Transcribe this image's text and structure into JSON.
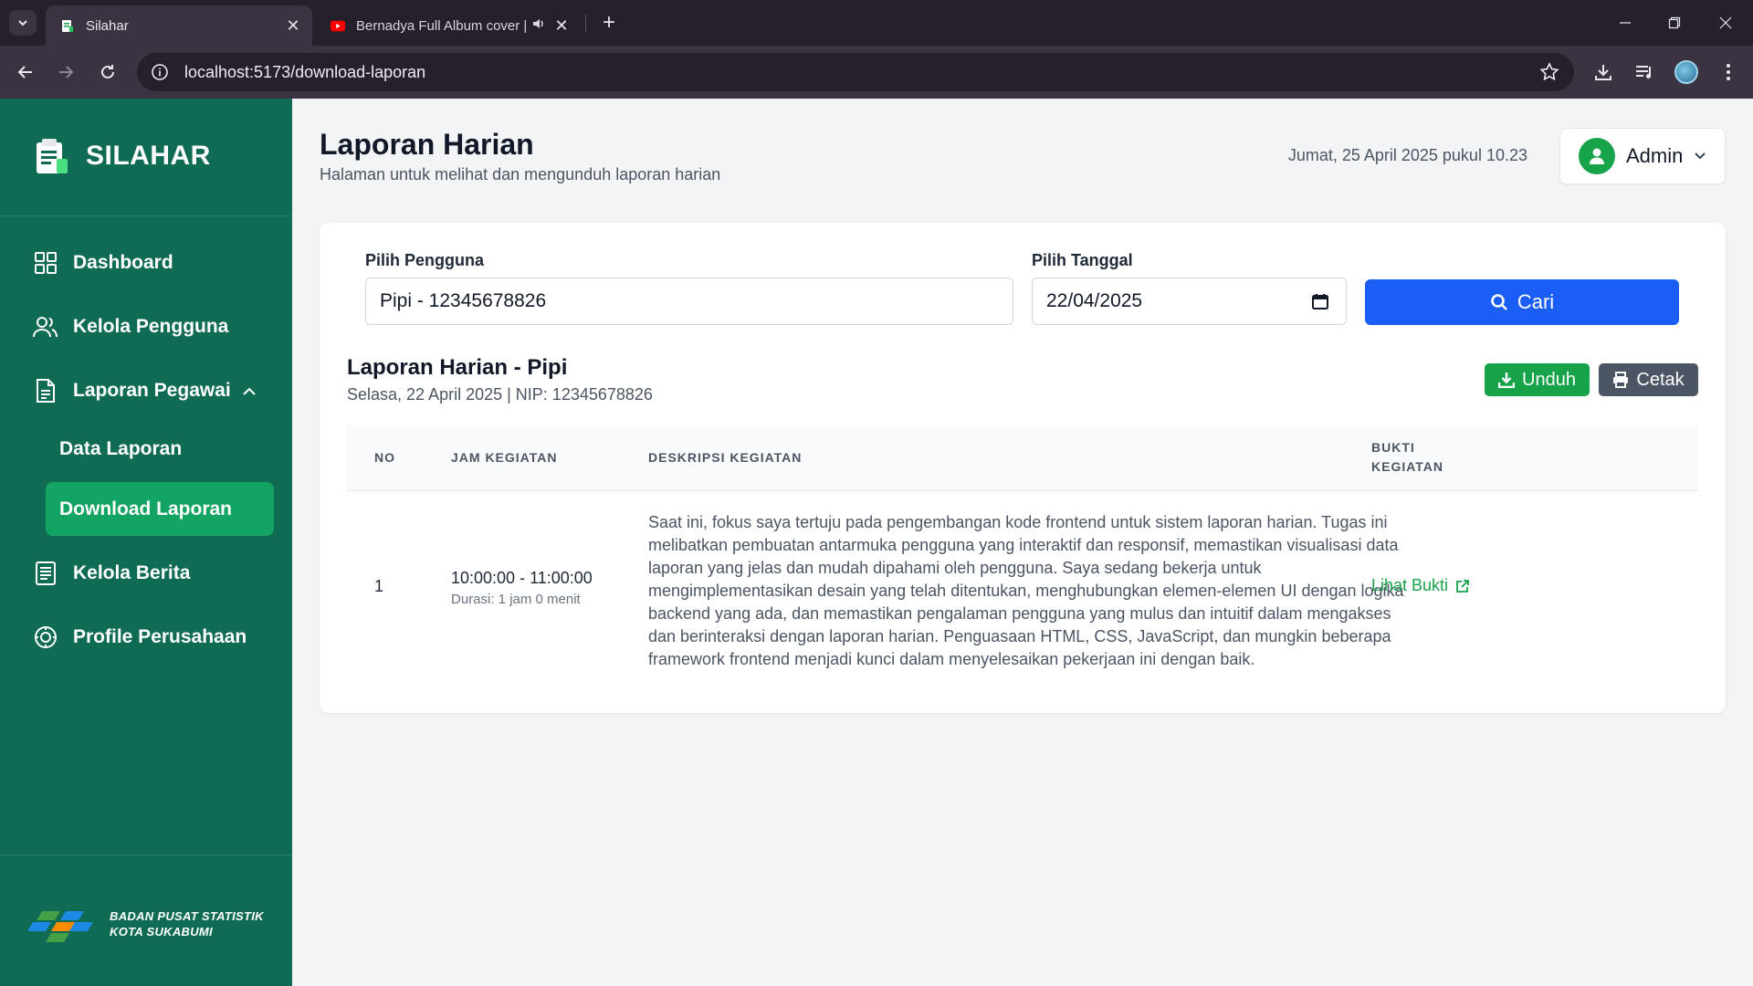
{
  "browser": {
    "tabs": [
      {
        "title": "Silahar",
        "active": true
      },
      {
        "title": "Bernadya Full Album cover |",
        "active": false
      }
    ],
    "url": "localhost:5173/download-laporan"
  },
  "sidebar": {
    "brand": "SILAHAR",
    "items": [
      {
        "label": "Dashboard",
        "icon": "grid-icon"
      },
      {
        "label": "Kelola Pengguna",
        "icon": "users-icon"
      },
      {
        "label": "Laporan Pegawai",
        "icon": "document-icon"
      },
      {
        "label": "Kelola Berita",
        "icon": "news-icon"
      },
      {
        "label": "Profile Perusahaan",
        "icon": "company-icon"
      }
    ],
    "subitems": [
      {
        "label": "Data Laporan",
        "active": false
      },
      {
        "label": "Download Laporan",
        "active": true
      }
    ],
    "footer": {
      "line1": "BADAN PUSAT STATISTIK",
      "line2": "KOTA SUKABUMI"
    }
  },
  "header": {
    "title": "Laporan Harian",
    "subtitle": "Halaman untuk melihat dan mengunduh laporan harian",
    "datetime": "Jumat, 25 April 2025 pukul 10.23",
    "user": "Admin"
  },
  "filter": {
    "user_label": "Pilih Pengguna",
    "user_value": "Pipi - 12345678826",
    "date_label": "Pilih Tanggal",
    "date_value": "22/04/2025",
    "search_label": "Cari"
  },
  "report": {
    "title": "Laporan Harian - Pipi",
    "meta": "Selasa, 22 April 2025 | NIP: 12345678826",
    "download_label": "Unduh",
    "print_label": "Cetak",
    "columns": [
      "NO",
      "JAM KEGIATAN",
      "DESKRIPSI KEGIATAN",
      "BUKTI",
      "KEGIATAN"
    ],
    "rows": [
      {
        "no": "1",
        "time": "10:00:00 - 11:00:00",
        "duration": "Durasi: 1 jam 0 menit",
        "desc_lines": [
          "Saat ini, fokus saya tertuju pada pengembangan kode frontend untuk sistem laporan harian. Tugas ini",
          "melibatkan pembuatan antarmuka pengguna yang interaktif dan responsif, memastikan visualisasi data",
          "laporan yang jelas dan mudah dipahami oleh pengguna. Saya sedang bekerja untuk",
          "mengimplementasikan desain yang telah ditentukan, menghubungkan elemen-elemen UI dengan logika",
          "backend yang ada, dan memastikan pengalaman pengguna yang mulus dan intuitif dalam mengakses",
          "dan berinteraksi dengan laporan harian. Penguasaan HTML, CSS, JavaScript, dan mungkin beberapa",
          "framework frontend menjadi kunci dalam menyelesaikan pekerjaan ini dengan baik."
        ],
        "proof_label": "Lihat Bukti"
      }
    ]
  },
  "colors": {
    "sidebar": "#0f6b53",
    "active_item": "#13a463",
    "primary": "#1a5ef6",
    "success": "#16a34a",
    "secondary": "#4b5563"
  }
}
